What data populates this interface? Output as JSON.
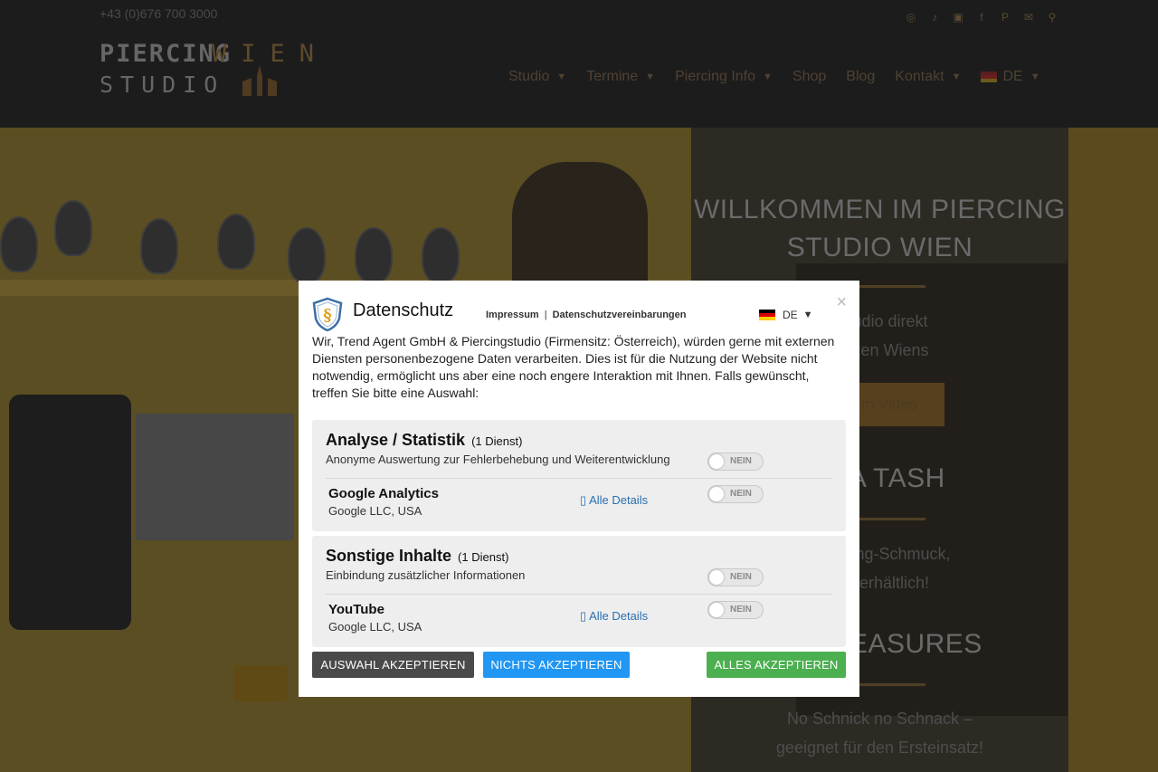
{
  "header": {
    "phone": "+43 (0)676 700 3000",
    "social_icons": [
      "instagram-icon",
      "tiktok-icon",
      "youtube-icon",
      "facebook-icon",
      "pinterest-icon",
      "mail-icon",
      "search-icon"
    ],
    "logo": {
      "line1": "PIERCING",
      "line2": "STUDIO",
      "line3": "WIEN"
    },
    "nav": {
      "studio": "Studio",
      "termine": "Termine",
      "piercing_info": "Piercing Info",
      "shop": "Shop",
      "blog": "Blog",
      "kontakt": "Kontakt",
      "lang": "DE"
    }
  },
  "hero": {
    "title": "WILLKOMMEN IM PIERCING STUDIO WIEN",
    "text1": "…tudio direkt",
    "text1b": "…rzen Wiens",
    "button": "…m Video",
    "title2": "… A TASH",
    "text2": "…iercing-Schmuck,",
    "text2b": "…s erhältlich!",
    "title3": "… TREASURES",
    "text3": "No Schnick no Schnack –",
    "text3b": "geeignet für den Ersteinsatz!"
  },
  "consent": {
    "title": "Datenschutz",
    "link_impressum": "Impressum",
    "link_separator": "|",
    "link_privacy": "Datenschutzvereinbarungen",
    "lang": "DE",
    "intro": "Wir, Trend Agent GmbH & Piercingstudio (Firmensitz: Österreich), würden gerne mit externen Diensten personenbezogene Daten verarbeiten. Dies ist für die Nutzung der Website nicht notwendig, ermöglicht uns aber eine noch engere Interaktion mit Ihnen. Falls gewünscht, treffen Sie bitte eine Auswahl:",
    "groups": [
      {
        "title": "Analyse / Statistik",
        "count": "(1 Dienst)",
        "description": "Anonyme Auswertung zur Fehlerbehebung und Weiterentwicklung",
        "toggle": "NEIN",
        "service": {
          "name": "Google Analytics",
          "vendor": "Google LLC, USA",
          "details": "Alle Details",
          "toggle": "NEIN"
        }
      },
      {
        "title": "Sonstige Inhalte",
        "count": "(1 Dienst)",
        "description": "Einbindung zusätzlicher Informationen",
        "toggle": "NEIN",
        "service": {
          "name": "YouTube",
          "vendor": "Google LLC, USA",
          "details": "Alle Details",
          "toggle": "NEIN"
        }
      }
    ],
    "buttons": {
      "accept_selection": "AUSWAHL AKZEPTIEREN",
      "accept_none": "NICHTS AKZEPTIEREN",
      "accept_all": "ALLES AKZEPTIEREN"
    },
    "colors": {
      "accept_selection": "#4a4a4a",
      "accept_none": "#2196f3",
      "accept_all": "#4caf50"
    }
  }
}
